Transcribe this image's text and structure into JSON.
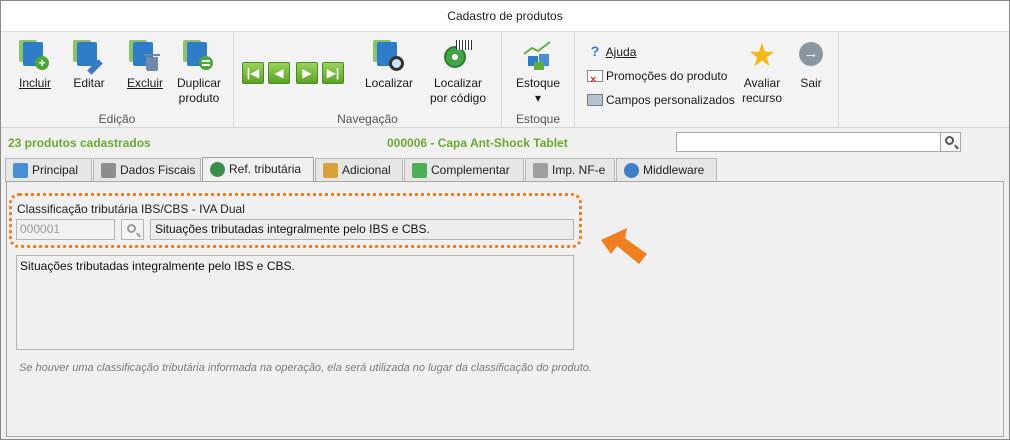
{
  "window": {
    "title": "Cadastro de produtos"
  },
  "ribbon": {
    "edicao": {
      "label": "Edição",
      "buttons": [
        {
          "label": "Incluir",
          "icon": "add-product-icon"
        },
        {
          "label": "Editar",
          "icon": "edit-product-icon"
        },
        {
          "label": "Excluir",
          "icon": "delete-product-icon"
        },
        {
          "label_line1": "Duplicar",
          "label_line2": "produto",
          "icon": "duplicate-product-icon"
        }
      ]
    },
    "navegacao": {
      "label": "Navegação",
      "nav_buttons": [
        "first",
        "previous",
        "next",
        "last"
      ],
      "localizar": "Localizar",
      "localizar_codigo_line1": "Localizar",
      "localizar_codigo_line2": "por código"
    },
    "estoque": {
      "label": "Estoque",
      "button": "Estoque",
      "dropdown": "▾"
    },
    "extras": {
      "ajuda": "Ajuda",
      "promocoes": "Promoções do produto",
      "campos": "Campos personalizados",
      "avaliar_line1": "Avaliar",
      "avaliar_line2": "recurso",
      "sair": "Sair"
    }
  },
  "status": {
    "count": "23 produtos cadastrados",
    "current_product": "000006 - Capa Ant-Shock Tablet",
    "search_value": ""
  },
  "tabs": [
    {
      "label": "Principal",
      "active": false,
      "icon_color": "#4a8fd4"
    },
    {
      "label": "Dados Fiscais",
      "active": false,
      "icon_color": "#8d8d8d"
    },
    {
      "label": "Ref. tributária",
      "active": true,
      "icon_color": "#3a8d4a"
    },
    {
      "label": "Adicional",
      "active": false,
      "icon_color": "#d9a13a"
    },
    {
      "label": "Complementar",
      "active": false,
      "icon_color": "#4cae55"
    },
    {
      "label": "Imp. NF-e",
      "active": false,
      "icon_color": "#9e9e9e"
    },
    {
      "label": "Middleware",
      "active": false,
      "icon_color": "#3f7fc8"
    }
  ],
  "ref_tributaria": {
    "section_label": "Classificação tributária IBS/CBS - IVA Dual",
    "code": "000001",
    "description": "Situações tributadas integralmente pelo IBS e CBS.",
    "memo": "Situações tributadas integralmente pelo IBS e CBS.",
    "note": "Se houver uma classificação tributária informada na operação, ela será utilizada no lugar da classificação do produto."
  },
  "colors": {
    "accent_green": "#6aa92f",
    "highlight_orange": "#f07f22"
  }
}
